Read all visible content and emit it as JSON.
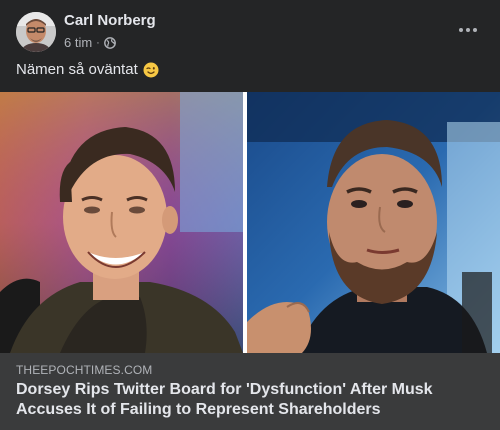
{
  "post": {
    "author": "Carl Norberg",
    "timestamp": "6 tim",
    "separator": "·",
    "privacy_icon": "globe-icon",
    "menu_icon": "more-horizontal-icon",
    "text": "Nämen så oväntat",
    "emoji_icon": "winking-face-emoji-icon"
  },
  "link_preview": {
    "domain": "THEEPOCHTIMES.COM",
    "title": "Dorsey Rips Twitter Board for 'Dysfunction' After Musk Accuses It of Failing to Represent Shareholders"
  },
  "colors": {
    "background": "#242526",
    "preview_background": "#3a3b3c",
    "primary_text": "#e4e6eb",
    "secondary_text": "#b0b3b8"
  }
}
